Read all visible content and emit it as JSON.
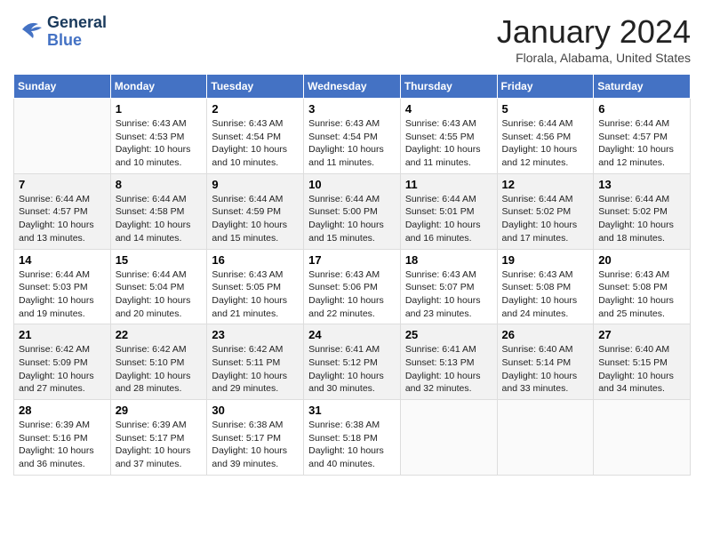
{
  "header": {
    "logo": {
      "general": "General",
      "blue": "Blue"
    },
    "title": "January 2024",
    "subtitle": "Florala, Alabama, United States"
  },
  "calendar": {
    "days_of_week": [
      "Sunday",
      "Monday",
      "Tuesday",
      "Wednesday",
      "Thursday",
      "Friday",
      "Saturday"
    ],
    "weeks": [
      [
        {
          "day": "",
          "info": ""
        },
        {
          "day": "1",
          "info": "Sunrise: 6:43 AM\nSunset: 4:53 PM\nDaylight: 10 hours\nand 10 minutes."
        },
        {
          "day": "2",
          "info": "Sunrise: 6:43 AM\nSunset: 4:54 PM\nDaylight: 10 hours\nand 10 minutes."
        },
        {
          "day": "3",
          "info": "Sunrise: 6:43 AM\nSunset: 4:54 PM\nDaylight: 10 hours\nand 11 minutes."
        },
        {
          "day": "4",
          "info": "Sunrise: 6:43 AM\nSunset: 4:55 PM\nDaylight: 10 hours\nand 11 minutes."
        },
        {
          "day": "5",
          "info": "Sunrise: 6:44 AM\nSunset: 4:56 PM\nDaylight: 10 hours\nand 12 minutes."
        },
        {
          "day": "6",
          "info": "Sunrise: 6:44 AM\nSunset: 4:57 PM\nDaylight: 10 hours\nand 12 minutes."
        }
      ],
      [
        {
          "day": "7",
          "info": "Sunrise: 6:44 AM\nSunset: 4:57 PM\nDaylight: 10 hours\nand 13 minutes."
        },
        {
          "day": "8",
          "info": "Sunrise: 6:44 AM\nSunset: 4:58 PM\nDaylight: 10 hours\nand 14 minutes."
        },
        {
          "day": "9",
          "info": "Sunrise: 6:44 AM\nSunset: 4:59 PM\nDaylight: 10 hours\nand 15 minutes."
        },
        {
          "day": "10",
          "info": "Sunrise: 6:44 AM\nSunset: 5:00 PM\nDaylight: 10 hours\nand 15 minutes."
        },
        {
          "day": "11",
          "info": "Sunrise: 6:44 AM\nSunset: 5:01 PM\nDaylight: 10 hours\nand 16 minutes."
        },
        {
          "day": "12",
          "info": "Sunrise: 6:44 AM\nSunset: 5:02 PM\nDaylight: 10 hours\nand 17 minutes."
        },
        {
          "day": "13",
          "info": "Sunrise: 6:44 AM\nSunset: 5:02 PM\nDaylight: 10 hours\nand 18 minutes."
        }
      ],
      [
        {
          "day": "14",
          "info": "Sunrise: 6:44 AM\nSunset: 5:03 PM\nDaylight: 10 hours\nand 19 minutes."
        },
        {
          "day": "15",
          "info": "Sunrise: 6:44 AM\nSunset: 5:04 PM\nDaylight: 10 hours\nand 20 minutes."
        },
        {
          "day": "16",
          "info": "Sunrise: 6:43 AM\nSunset: 5:05 PM\nDaylight: 10 hours\nand 21 minutes."
        },
        {
          "day": "17",
          "info": "Sunrise: 6:43 AM\nSunset: 5:06 PM\nDaylight: 10 hours\nand 22 minutes."
        },
        {
          "day": "18",
          "info": "Sunrise: 6:43 AM\nSunset: 5:07 PM\nDaylight: 10 hours\nand 23 minutes."
        },
        {
          "day": "19",
          "info": "Sunrise: 6:43 AM\nSunset: 5:08 PM\nDaylight: 10 hours\nand 24 minutes."
        },
        {
          "day": "20",
          "info": "Sunrise: 6:43 AM\nSunset: 5:08 PM\nDaylight: 10 hours\nand 25 minutes."
        }
      ],
      [
        {
          "day": "21",
          "info": "Sunrise: 6:42 AM\nSunset: 5:09 PM\nDaylight: 10 hours\nand 27 minutes."
        },
        {
          "day": "22",
          "info": "Sunrise: 6:42 AM\nSunset: 5:10 PM\nDaylight: 10 hours\nand 28 minutes."
        },
        {
          "day": "23",
          "info": "Sunrise: 6:42 AM\nSunset: 5:11 PM\nDaylight: 10 hours\nand 29 minutes."
        },
        {
          "day": "24",
          "info": "Sunrise: 6:41 AM\nSunset: 5:12 PM\nDaylight: 10 hours\nand 30 minutes."
        },
        {
          "day": "25",
          "info": "Sunrise: 6:41 AM\nSunset: 5:13 PM\nDaylight: 10 hours\nand 32 minutes."
        },
        {
          "day": "26",
          "info": "Sunrise: 6:40 AM\nSunset: 5:14 PM\nDaylight: 10 hours\nand 33 minutes."
        },
        {
          "day": "27",
          "info": "Sunrise: 6:40 AM\nSunset: 5:15 PM\nDaylight: 10 hours\nand 34 minutes."
        }
      ],
      [
        {
          "day": "28",
          "info": "Sunrise: 6:39 AM\nSunset: 5:16 PM\nDaylight: 10 hours\nand 36 minutes."
        },
        {
          "day": "29",
          "info": "Sunrise: 6:39 AM\nSunset: 5:17 PM\nDaylight: 10 hours\nand 37 minutes."
        },
        {
          "day": "30",
          "info": "Sunrise: 6:38 AM\nSunset: 5:17 PM\nDaylight: 10 hours\nand 39 minutes."
        },
        {
          "day": "31",
          "info": "Sunrise: 6:38 AM\nSunset: 5:18 PM\nDaylight: 10 hours\nand 40 minutes."
        },
        {
          "day": "",
          "info": ""
        },
        {
          "day": "",
          "info": ""
        },
        {
          "day": "",
          "info": ""
        }
      ]
    ]
  }
}
